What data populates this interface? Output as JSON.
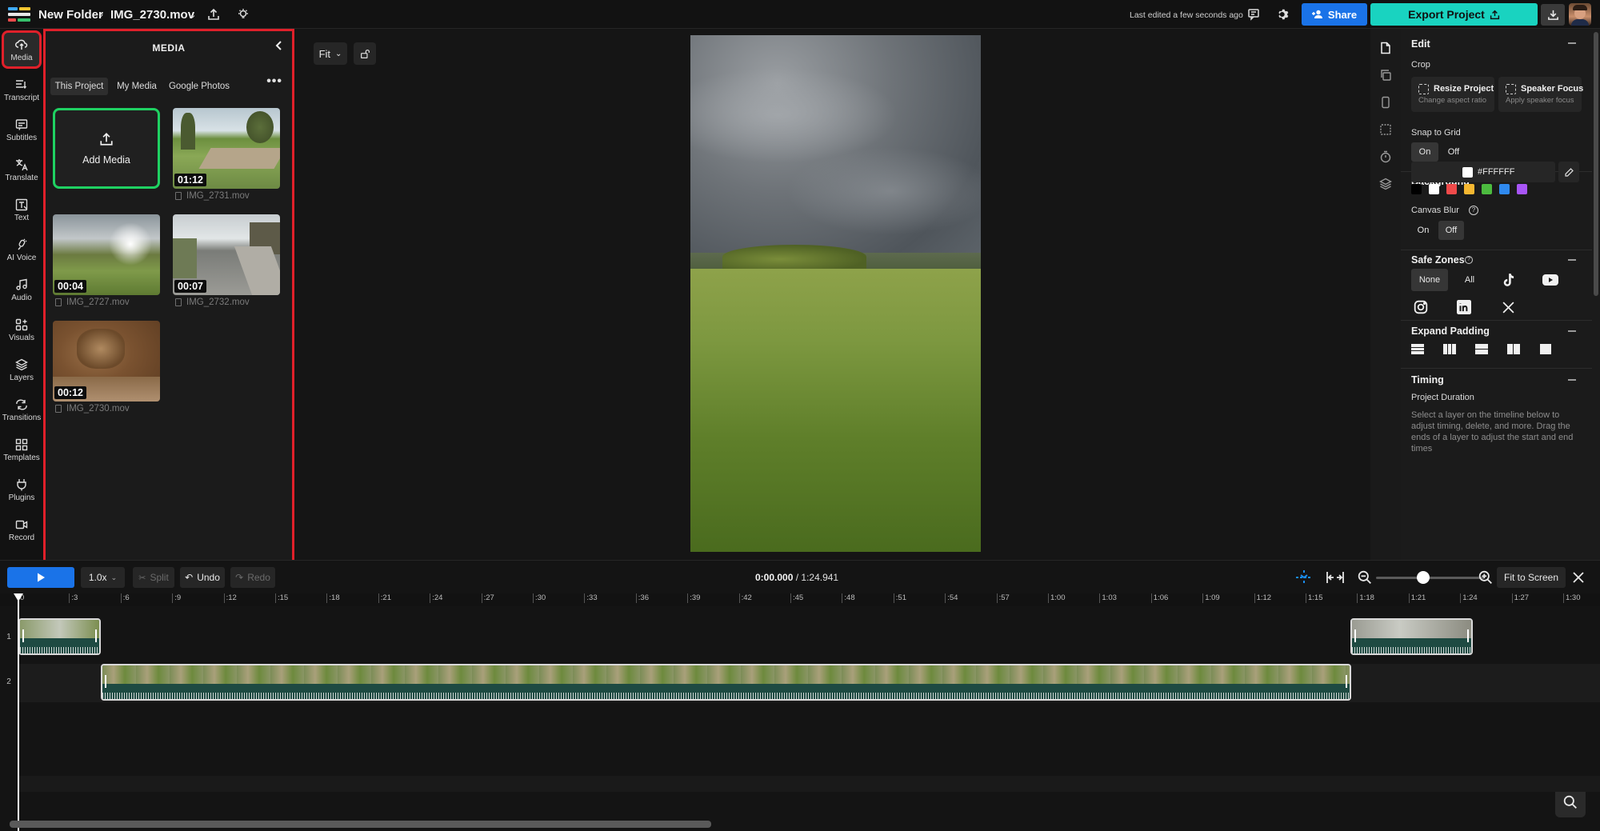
{
  "topbar": {
    "folder": "New Folder",
    "filename": "IMG_2730.mov",
    "last_edited": "Last edited a few seconds ago",
    "share_label": "Share",
    "export_label": "Export Project"
  },
  "rail": {
    "items": [
      {
        "label": "Media",
        "icon": "media-icon"
      },
      {
        "label": "Transcript",
        "icon": "transcript-icon"
      },
      {
        "label": "Subtitles",
        "icon": "subtitles-icon"
      },
      {
        "label": "Translate",
        "icon": "translate-icon"
      },
      {
        "label": "Text",
        "icon": "text-icon"
      },
      {
        "label": "AI Voice",
        "icon": "ai-voice-icon"
      },
      {
        "label": "Audio",
        "icon": "audio-icon"
      },
      {
        "label": "Visuals",
        "icon": "visuals-icon"
      },
      {
        "label": "Layers",
        "icon": "layers-icon"
      },
      {
        "label": "Transitions",
        "icon": "transitions-icon"
      },
      {
        "label": "Templates",
        "icon": "templates-icon"
      },
      {
        "label": "Plugins",
        "icon": "plugins-icon"
      },
      {
        "label": "Record",
        "icon": "record-icon"
      }
    ]
  },
  "media": {
    "title": "MEDIA",
    "tabs": [
      "This Project",
      "My Media",
      "Google Photos"
    ],
    "add_label": "Add Media",
    "items": [
      {
        "duration": "01:12",
        "name": "IMG_2731.mov"
      },
      {
        "duration": "00:04",
        "name": "IMG_2727.mov"
      },
      {
        "duration": "00:07",
        "name": "IMG_2732.mov"
      },
      {
        "duration": "00:12",
        "name": "IMG_2730.mov"
      }
    ]
  },
  "canvas": {
    "fit_label": "Fit"
  },
  "props": {
    "edit_title": "Edit",
    "crop_label": "Crop",
    "resize": {
      "title": "Resize Project",
      "sub": "Change aspect ratio"
    },
    "speaker": {
      "title": "Speaker Focus",
      "sub": "Apply speaker focus"
    },
    "snap_label": "Snap to Grid",
    "on": "On",
    "off": "Off",
    "background_title": "Background",
    "background_value": "#FFFFFF",
    "swatches": [
      "#000000",
      "#ffffff",
      "#f04a4a",
      "#f5b731",
      "#4cbb3f",
      "#2f8af0",
      "#a855f7"
    ],
    "canvas_blur_label": "Canvas Blur",
    "safe_zones_title": "Safe Zones",
    "safe_none": "None",
    "safe_all": "All",
    "expand_padding_title": "Expand Padding",
    "timing_title": "Timing",
    "project_duration_label": "Project Duration",
    "timing_desc": "Select a layer on the timeline below to adjust timing, delete, and more. Drag the ends of a layer to adjust the start and end times"
  },
  "timeline": {
    "speed": "1.0x",
    "split": "Split",
    "undo": "Undo",
    "redo": "Redo",
    "current_time": "0:00.000",
    "total_time": "1:24.941",
    "fit_screen": "Fit to Screen",
    "zoom_level": 0.44,
    "ticks": [
      "0",
      ":3",
      ":6",
      ":9",
      ":12",
      ":15",
      ":18",
      ":21",
      ":24",
      ":27",
      ":30",
      ":33",
      ":36",
      ":39",
      ":42",
      ":45",
      ":48",
      ":51",
      ":54",
      ":57",
      "1:00",
      "1:03",
      "1:06",
      "1:09",
      "1:12",
      "1:15",
      "1:18",
      "1:21",
      "1:24",
      "1:27",
      "1:30"
    ],
    "track_numbers": [
      "1",
      "2"
    ]
  }
}
